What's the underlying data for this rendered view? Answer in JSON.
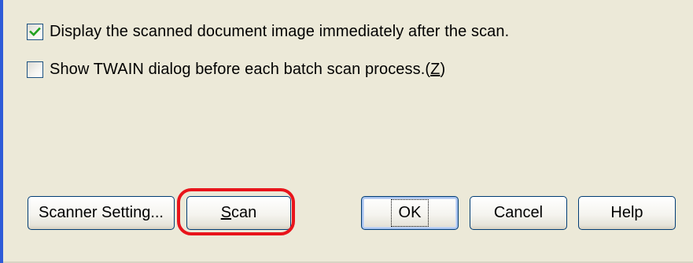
{
  "options": {
    "display_after_scan": {
      "label": "Display the scanned document image immediately after the scan.",
      "checked": true
    },
    "show_twain": {
      "label": "Show TWAIN dialog before each batch scan process.",
      "hotkey": "Z",
      "checked": false
    }
  },
  "buttons": {
    "scanner_setting": "Scanner Setting...",
    "scan_hotkey": "S",
    "scan_rest": "can",
    "ok": "OK",
    "cancel": "Cancel",
    "help": "Help"
  },
  "colors": {
    "dialog_bg": "#ECE9D8",
    "highlight": "#E8141B",
    "checkmark": "#21A121",
    "button_border": "#003C74"
  }
}
